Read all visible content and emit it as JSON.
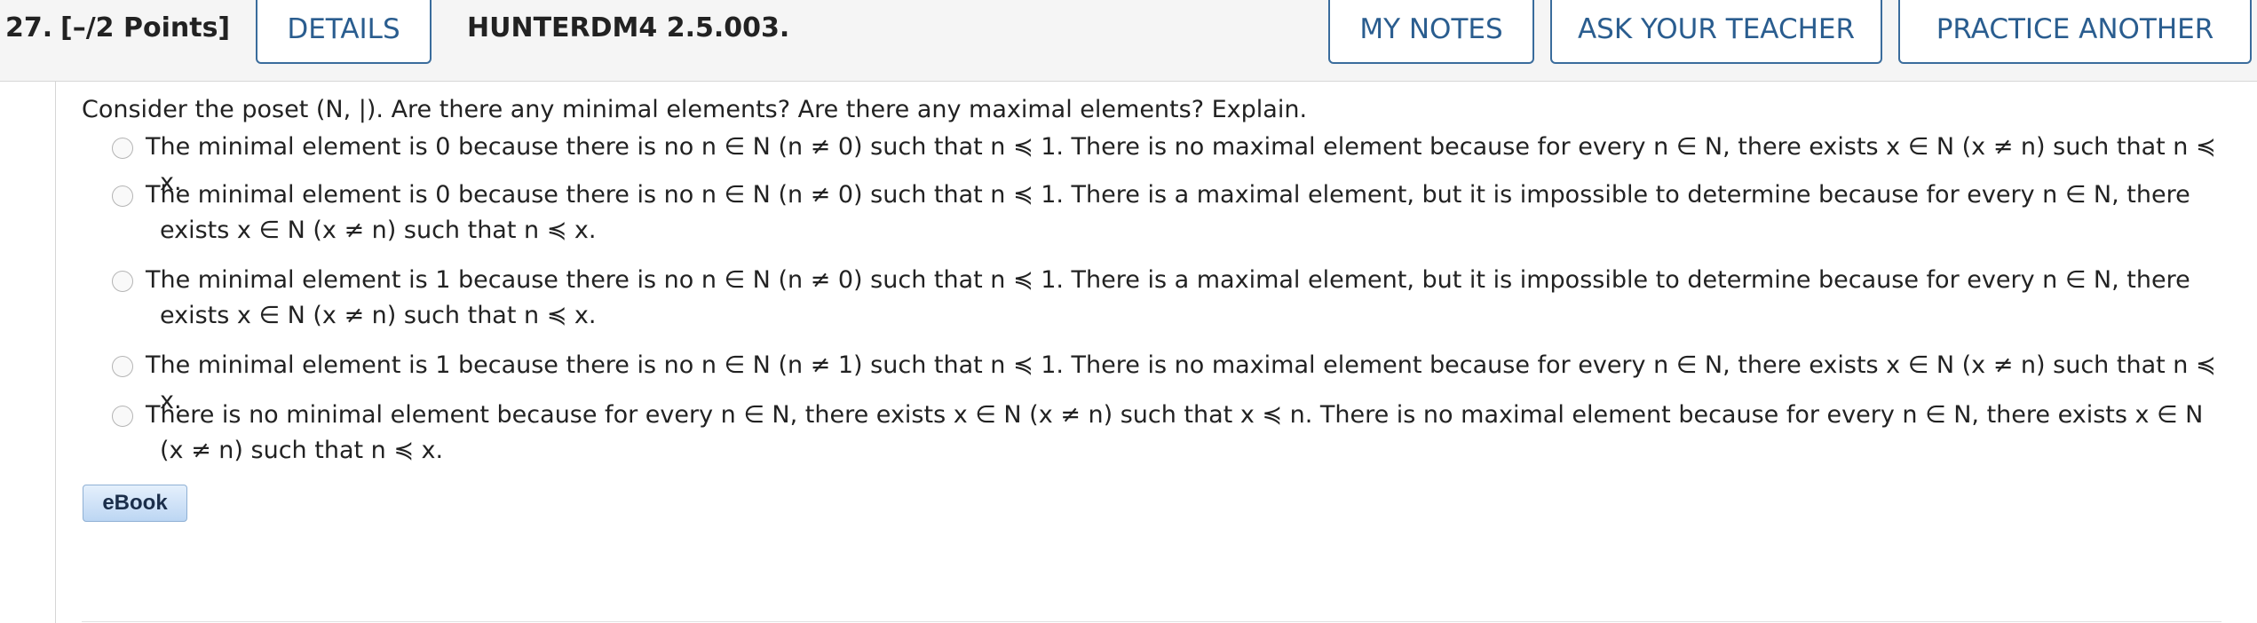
{
  "header": {
    "question_number": "27.",
    "points": "[–/2 Points]",
    "details_label": "DETAILS",
    "reference": "HUNTERDM4 2.5.003.",
    "my_notes_label": "MY NOTES",
    "ask_teacher_label": "ASK YOUR TEACHER",
    "practice_label": "PRACTICE ANOTHER"
  },
  "question": {
    "prompt": "Consider the poset (N, |). Are there any minimal elements? Are there any maximal elements? Explain."
  },
  "choices": [
    {
      "text": "The minimal element is 0 because there is no n ∈ N (n ≠ 0) such that n ≼ 1. There is no maximal element because for every n ∈ N, there exists x ∈ N (x ≠ n) such that n ≼ x.",
      "selected": false
    },
    {
      "text": "The minimal element is 0 because there is no n ∈ N (n ≠ 0) such that n ≼ 1. There is a maximal element, but it is impossible to determine because for every n ∈ N, there exists x ∈ N (x ≠ n) such that n ≼ x.",
      "selected": false
    },
    {
      "text": "The minimal element is 1 because there is no n ∈ N (n ≠ 0) such that n ≼ 1. There is a maximal element, but it is impossible to determine because for every n ∈ N, there exists x ∈ N (x ≠ n) such that n ≼ x.",
      "selected": false
    },
    {
      "text": "The minimal element is 1 because there is no n ∈ N (n ≠ 1) such that n ≼ 1. There is no maximal element because for every n ∈ N, there exists x ∈ N (x ≠ n) such that n ≼ x.",
      "selected": false
    },
    {
      "text": "There is no minimal element because for every n ∈ N, there exists x ∈ N (x ≠ n) such that x ≼ n. There is no maximal element because for every n ∈ N, there exists x ∈ N (x ≠ n) such that n ≼ x.",
      "selected": false
    }
  ],
  "ebook": {
    "label": "eBook"
  }
}
